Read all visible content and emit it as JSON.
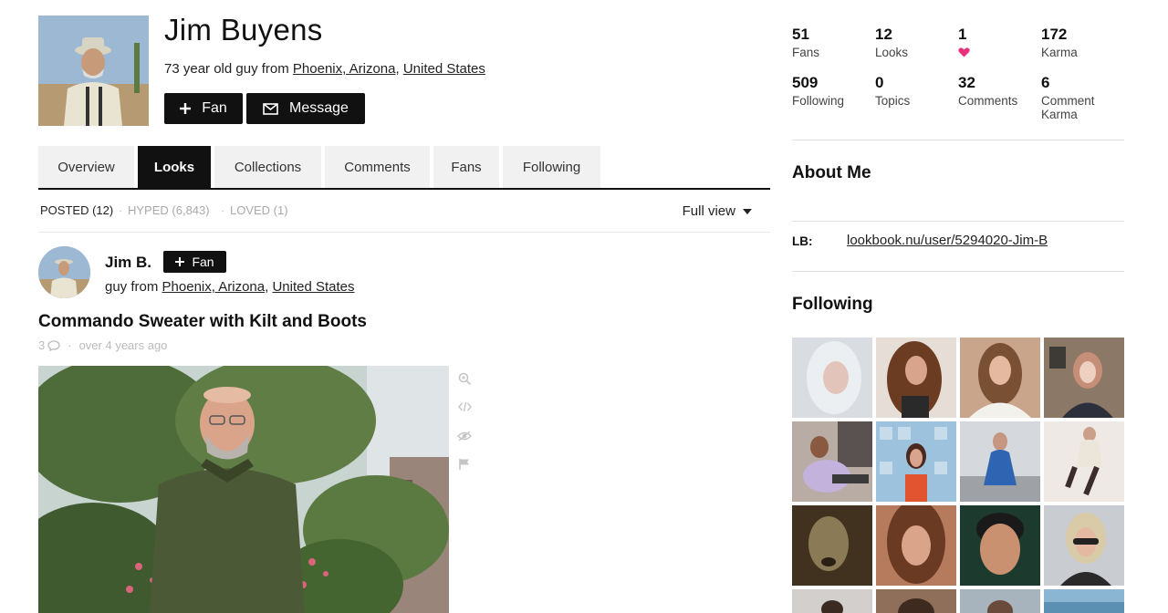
{
  "profile": {
    "name": "Jim Buyens",
    "bio_prefix": "73 year old guy from ",
    "city": "Phoenix, Arizona",
    "country": "United States",
    "fan_label": "Fan",
    "message_label": "Message"
  },
  "tabs": [
    {
      "label": "Overview"
    },
    {
      "label": "Looks"
    },
    {
      "label": "Collections"
    },
    {
      "label": "Comments"
    },
    {
      "label": "Fans"
    },
    {
      "label": "Following"
    }
  ],
  "filters": {
    "posted": "POSTED (12)",
    "hyped": "HYPED (6,843)",
    "loved": "LOVED (1)",
    "separator": "·",
    "view": "Full view"
  },
  "post": {
    "author": "Jim B.",
    "fan_label": "Fan",
    "location_prefix": "guy from ",
    "city": "Phoenix, Arizona",
    "country": "United States",
    "title": "Commando Sweater with Kilt and Boots",
    "comment_count": "3",
    "age": "over 4 years ago"
  },
  "stats": [
    {
      "num": "51",
      "label": "Fans"
    },
    {
      "num": "12",
      "label": "Looks"
    },
    {
      "num": "1",
      "label": ""
    },
    {
      "num": "172",
      "label": "Karma"
    },
    {
      "num": "509",
      "label": "Following"
    },
    {
      "num": "0",
      "label": "Topics"
    },
    {
      "num": "32",
      "label": "Comments"
    },
    {
      "num": "6",
      "label": "Comment Karma"
    }
  ],
  "about": {
    "title": "About Me",
    "lb_label": "LB:",
    "lb_link": "lookbook.nu/user/5294020-Jim-B"
  },
  "following_section": {
    "title": "Following"
  },
  "colors": {
    "accent_dark": "#111111",
    "heart": "#e8317a",
    "tab_bg": "#f1f1f1"
  }
}
